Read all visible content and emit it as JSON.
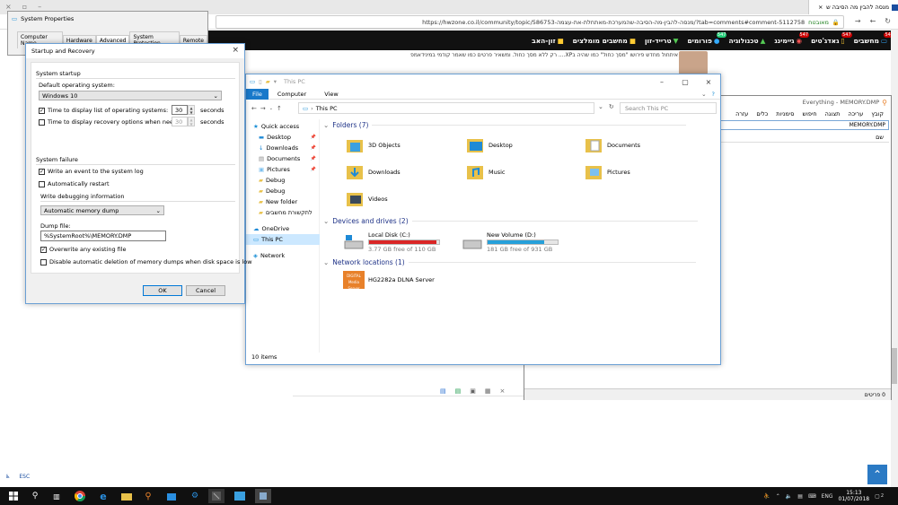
{
  "browser": {
    "tab_title": "מנסה להבין מה הסיבה ש",
    "url": "https://hwzone.co.il/community/topic/586753-מנסה-להבין-מה-הסיבה-שהמערכת-מאתחלת-את-עצמה/?tab=comments#comment-5112758",
    "security_label": "מאובטח",
    "nav": [
      {
        "label": "מחשבים",
        "badge": "547"
      },
      {
        "label": "גאדג'טים",
        "badge": "547"
      },
      {
        "label": "גיימינג",
        "badge": "547"
      },
      {
        "label": "טכנולוגיה",
        "badge": ""
      },
      {
        "label": "פורומים",
        "badge": "547"
      },
      {
        "label": "טרייד-זון",
        "badge": ""
      },
      {
        "label": "מחשבים מומלצים",
        "badge": ""
      },
      {
        "label": "זון-האב",
        "badge": ""
      }
    ],
    "post_text": "איתחול מחדש פירושו \"מסך כחול\" כמו שהיה בXP.... רק ללא מסך כחול. ומשאיר פרטים כמו שאמר קודמי במינידאמפ",
    "corner_label": "ESC"
  },
  "everything": {
    "title": "Everything - MEMORY.DMP",
    "menu": [
      "קובץ",
      "עריכה",
      "תצוגה",
      "חיפוש",
      "סימניות",
      "כלים",
      "עזרה"
    ],
    "search_value": "MEMORY.DMP",
    "column_name": "שם",
    "status": "0 פריטים"
  },
  "explorer": {
    "title": "This PC",
    "ribbon": {
      "file": "File",
      "tabs": [
        "Computer",
        "View"
      ]
    },
    "path": "This PC",
    "search_placeholder": "Search This PC",
    "sidebar": [
      {
        "label": "Quick access",
        "icon": "star-icon",
        "pin": false
      },
      {
        "label": "Desktop",
        "icon": "desktop-icon",
        "pin": true
      },
      {
        "label": "Downloads",
        "icon": "download-icon",
        "pin": true
      },
      {
        "label": "Documents",
        "icon": "documents-icon",
        "pin": true
      },
      {
        "label": "Pictures",
        "icon": "pictures-icon",
        "pin": true
      },
      {
        "label": "Debug",
        "icon": "folder-icon",
        "pin": false
      },
      {
        "label": "Debug",
        "icon": "folder-icon",
        "pin": false
      },
      {
        "label": "New folder",
        "icon": "folder-icon",
        "pin": false
      },
      {
        "label": "לתקשורת מחשבים",
        "icon": "folder-icon",
        "pin": false
      },
      {
        "label": "OneDrive",
        "icon": "cloud-icon",
        "pin": false
      },
      {
        "label": "This PC",
        "icon": "computer-icon",
        "pin": false
      },
      {
        "label": "Network",
        "icon": "network-icon",
        "pin": false
      }
    ],
    "folders_header": "Folders (7)",
    "folders": [
      "3D Objects",
      "Desktop",
      "Documents",
      "Downloads",
      "Music",
      "Pictures",
      "Videos"
    ],
    "devices_header": "Devices and drives (2)",
    "drives": [
      {
        "name": "Local Disk (C:)",
        "free": "3.77 GB free of 110 GB",
        "used_fraction": 0.966,
        "color": "#da2626"
      },
      {
        "name": "New Volume (D:)",
        "free": "181 GB free of 931 GB",
        "used_fraction": 0.806,
        "color": "#26a0da"
      }
    ],
    "network_header": "Network locations (1)",
    "network_item": "HG2282a DLNA Server",
    "network_logo_text": "DIGITAL",
    "network_logo_subtext": "Media Server",
    "status": "10 items"
  },
  "system_properties": {
    "title": "System Properties",
    "tabs": [
      "Computer Name",
      "Hardware",
      "Advanced",
      "System Protection",
      "Remote"
    ]
  },
  "startup_recovery": {
    "title": "Startup and Recovery",
    "system_startup_label": "System startup",
    "default_os_label": "Default operating system:",
    "default_os_value": "Windows 10",
    "display_list_label": "Time to display list of operating systems:",
    "display_list_checked": true,
    "display_list_value": "30",
    "display_recovery_label": "Time to display recovery options when needed:",
    "display_recovery_checked": false,
    "display_recovery_value": "30",
    "seconds": "seconds",
    "system_failure_label": "System failure",
    "write_event_label": "Write an event to the system log",
    "write_event_checked": true,
    "auto_restart_label": "Automatically restart",
    "auto_restart_checked": false,
    "debug_info_label": "Write debugging information",
    "debug_type": "Automatic memory dump",
    "dump_file_label": "Dump file:",
    "dump_file_value": "%SystemRoot%\\MEMORY.DMP",
    "overwrite_label": "Overwrite any existing file",
    "overwrite_checked": true,
    "disable_delete_label": "Disable automatic deletion of memory dumps when disk space is low",
    "disable_delete_checked": false,
    "ok": "OK",
    "cancel": "Cancel"
  },
  "taskbar": {
    "apps": [
      "start-icon",
      "search-icon",
      "task-view-icon",
      "chrome-icon",
      "edge-icon",
      "file-explorer-icon",
      "everything-icon",
      "store-icon",
      "tools-icon",
      "terminal-icon",
      "control-panel-icon",
      "system-icon"
    ],
    "language": "ENG",
    "time": "15:13",
    "date": "01/07/2018",
    "notifications": "2"
  }
}
